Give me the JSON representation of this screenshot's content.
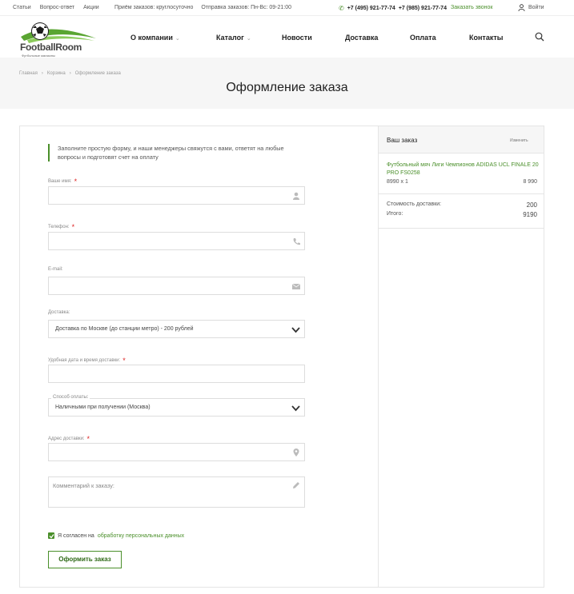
{
  "topbar": {
    "links": [
      "Статьи",
      "Вопрос-ответ",
      "Акции"
    ],
    "info": [
      "Приём заказов: круглосуточно",
      "Отправка заказов: Пн-Вс: 09-21:00"
    ],
    "phone1": "+7 (495) 921-77-74",
    "phone2": "+7 (985) 921-77-74",
    "callback": "Заказать звонок",
    "login": "Войти"
  },
  "logo": {
    "name": "FootballRoom",
    "tagline": "Футбольные магазины"
  },
  "nav": [
    "О компании",
    "Каталог",
    "Новости",
    "Доставка",
    "Оплата",
    "Контакты"
  ],
  "breadcrumbs": [
    "Главная",
    "Корзина",
    "Оформление заказа"
  ],
  "page_title": "Оформление заказа",
  "form": {
    "intro": "Заполните простую форму, и наши менеджеры свяжутся с вами, ответят на любые вопросы и подготовят счет на оплату",
    "name_label": "Ваше имя:",
    "phone_label": "Телефон:",
    "email_label": "E-mail:",
    "delivery_label": "Доставка:",
    "delivery_value": "Доставка по Москве (до станции метро) - 200 рублей",
    "date_label": "Удобная дата и время доставки:",
    "payment_label": "Способ оплаты:",
    "payment_value": "Наличными при получении (Москва)",
    "address_label": "Адрес доставки:",
    "comment_placeholder": "Комментарий к заказу:",
    "agree_prefix": "Я согласен на",
    "agree_link": "обработку персональных данных",
    "submit": "Оформить заказ"
  },
  "order": {
    "title": "Ваш заказ",
    "edit": "Изменить",
    "product": "Футбольный мяч Лиги Чемпионов ADIDAS UCL FINALE 20 PRO FS0258",
    "qty": "8990 x 1",
    "price": "8 990",
    "delivery_label": "Стоимость доставки:",
    "delivery_value": "200",
    "total_label": "Итого:",
    "total_value": "9190"
  },
  "colors": {
    "accent": "#4a8f2a",
    "required": "#dd2222"
  }
}
